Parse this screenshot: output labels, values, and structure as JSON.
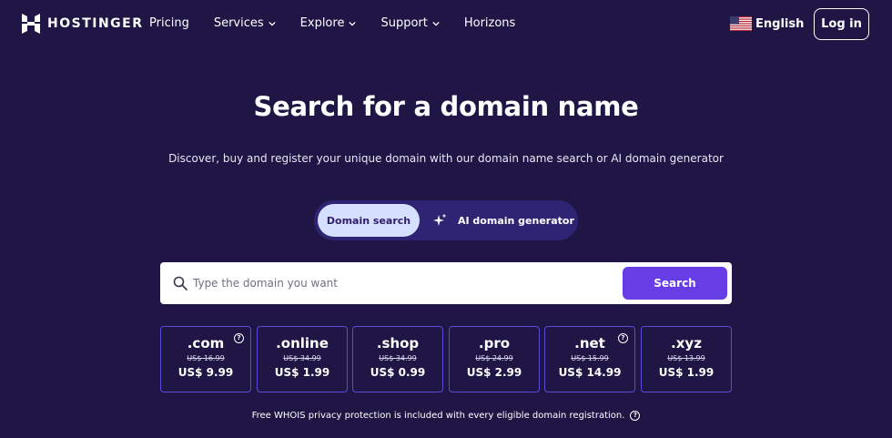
{
  "nav": {
    "brand": "HOSTINGER",
    "links": [
      {
        "label": "Pricing",
        "dropdown": false
      },
      {
        "label": "Services",
        "dropdown": true
      },
      {
        "label": "Explore",
        "dropdown": true
      },
      {
        "label": "Support",
        "dropdown": true
      },
      {
        "label": "Horizons",
        "dropdown": false
      }
    ],
    "language": "English",
    "login": "Log in"
  },
  "hero": {
    "title": "Search for a domain name",
    "subtitle": "Discover, buy and register your unique domain with our domain name search or AI domain generator"
  },
  "toggle": {
    "active": "Domain search",
    "ai": "AI domain generator"
  },
  "search": {
    "placeholder": "Type the domain you want",
    "button": "Search"
  },
  "tlds": [
    {
      "name": ".com",
      "old_price": "US$ 16.99",
      "price": "US$ 9.99",
      "help": true
    },
    {
      "name": ".online",
      "old_price": "US$ 34.99",
      "price": "US$ 1.99",
      "help": false
    },
    {
      "name": ".shop",
      "old_price": "US$ 34.99",
      "price": "US$ 0.99",
      "help": false
    },
    {
      "name": ".pro",
      "old_price": "US$ 24.99",
      "price": "US$ 2.99",
      "help": false
    },
    {
      "name": ".net",
      "old_price": "US$ 15.99",
      "price": "US$ 14.99",
      "help": true
    },
    {
      "name": ".xyz",
      "old_price": "US$ 13.99",
      "price": "US$ 1.99",
      "help": false
    }
  ],
  "footnote": "Free WHOIS privacy protection is included with every eligible domain registration.",
  "colors": {
    "background": "#1f1646",
    "accent": "#673de6",
    "toggle_bg": "#2f2474",
    "toggle_active": "#d5dfff",
    "card_border": "#5a4bd6"
  },
  "icons": {
    "logo": "hostinger-logo-icon",
    "chevron": "chevron-down-icon",
    "flag": "us-flag-icon",
    "sparkle": "sparkle-icon",
    "search": "search-icon",
    "help": "help-circle-icon"
  }
}
